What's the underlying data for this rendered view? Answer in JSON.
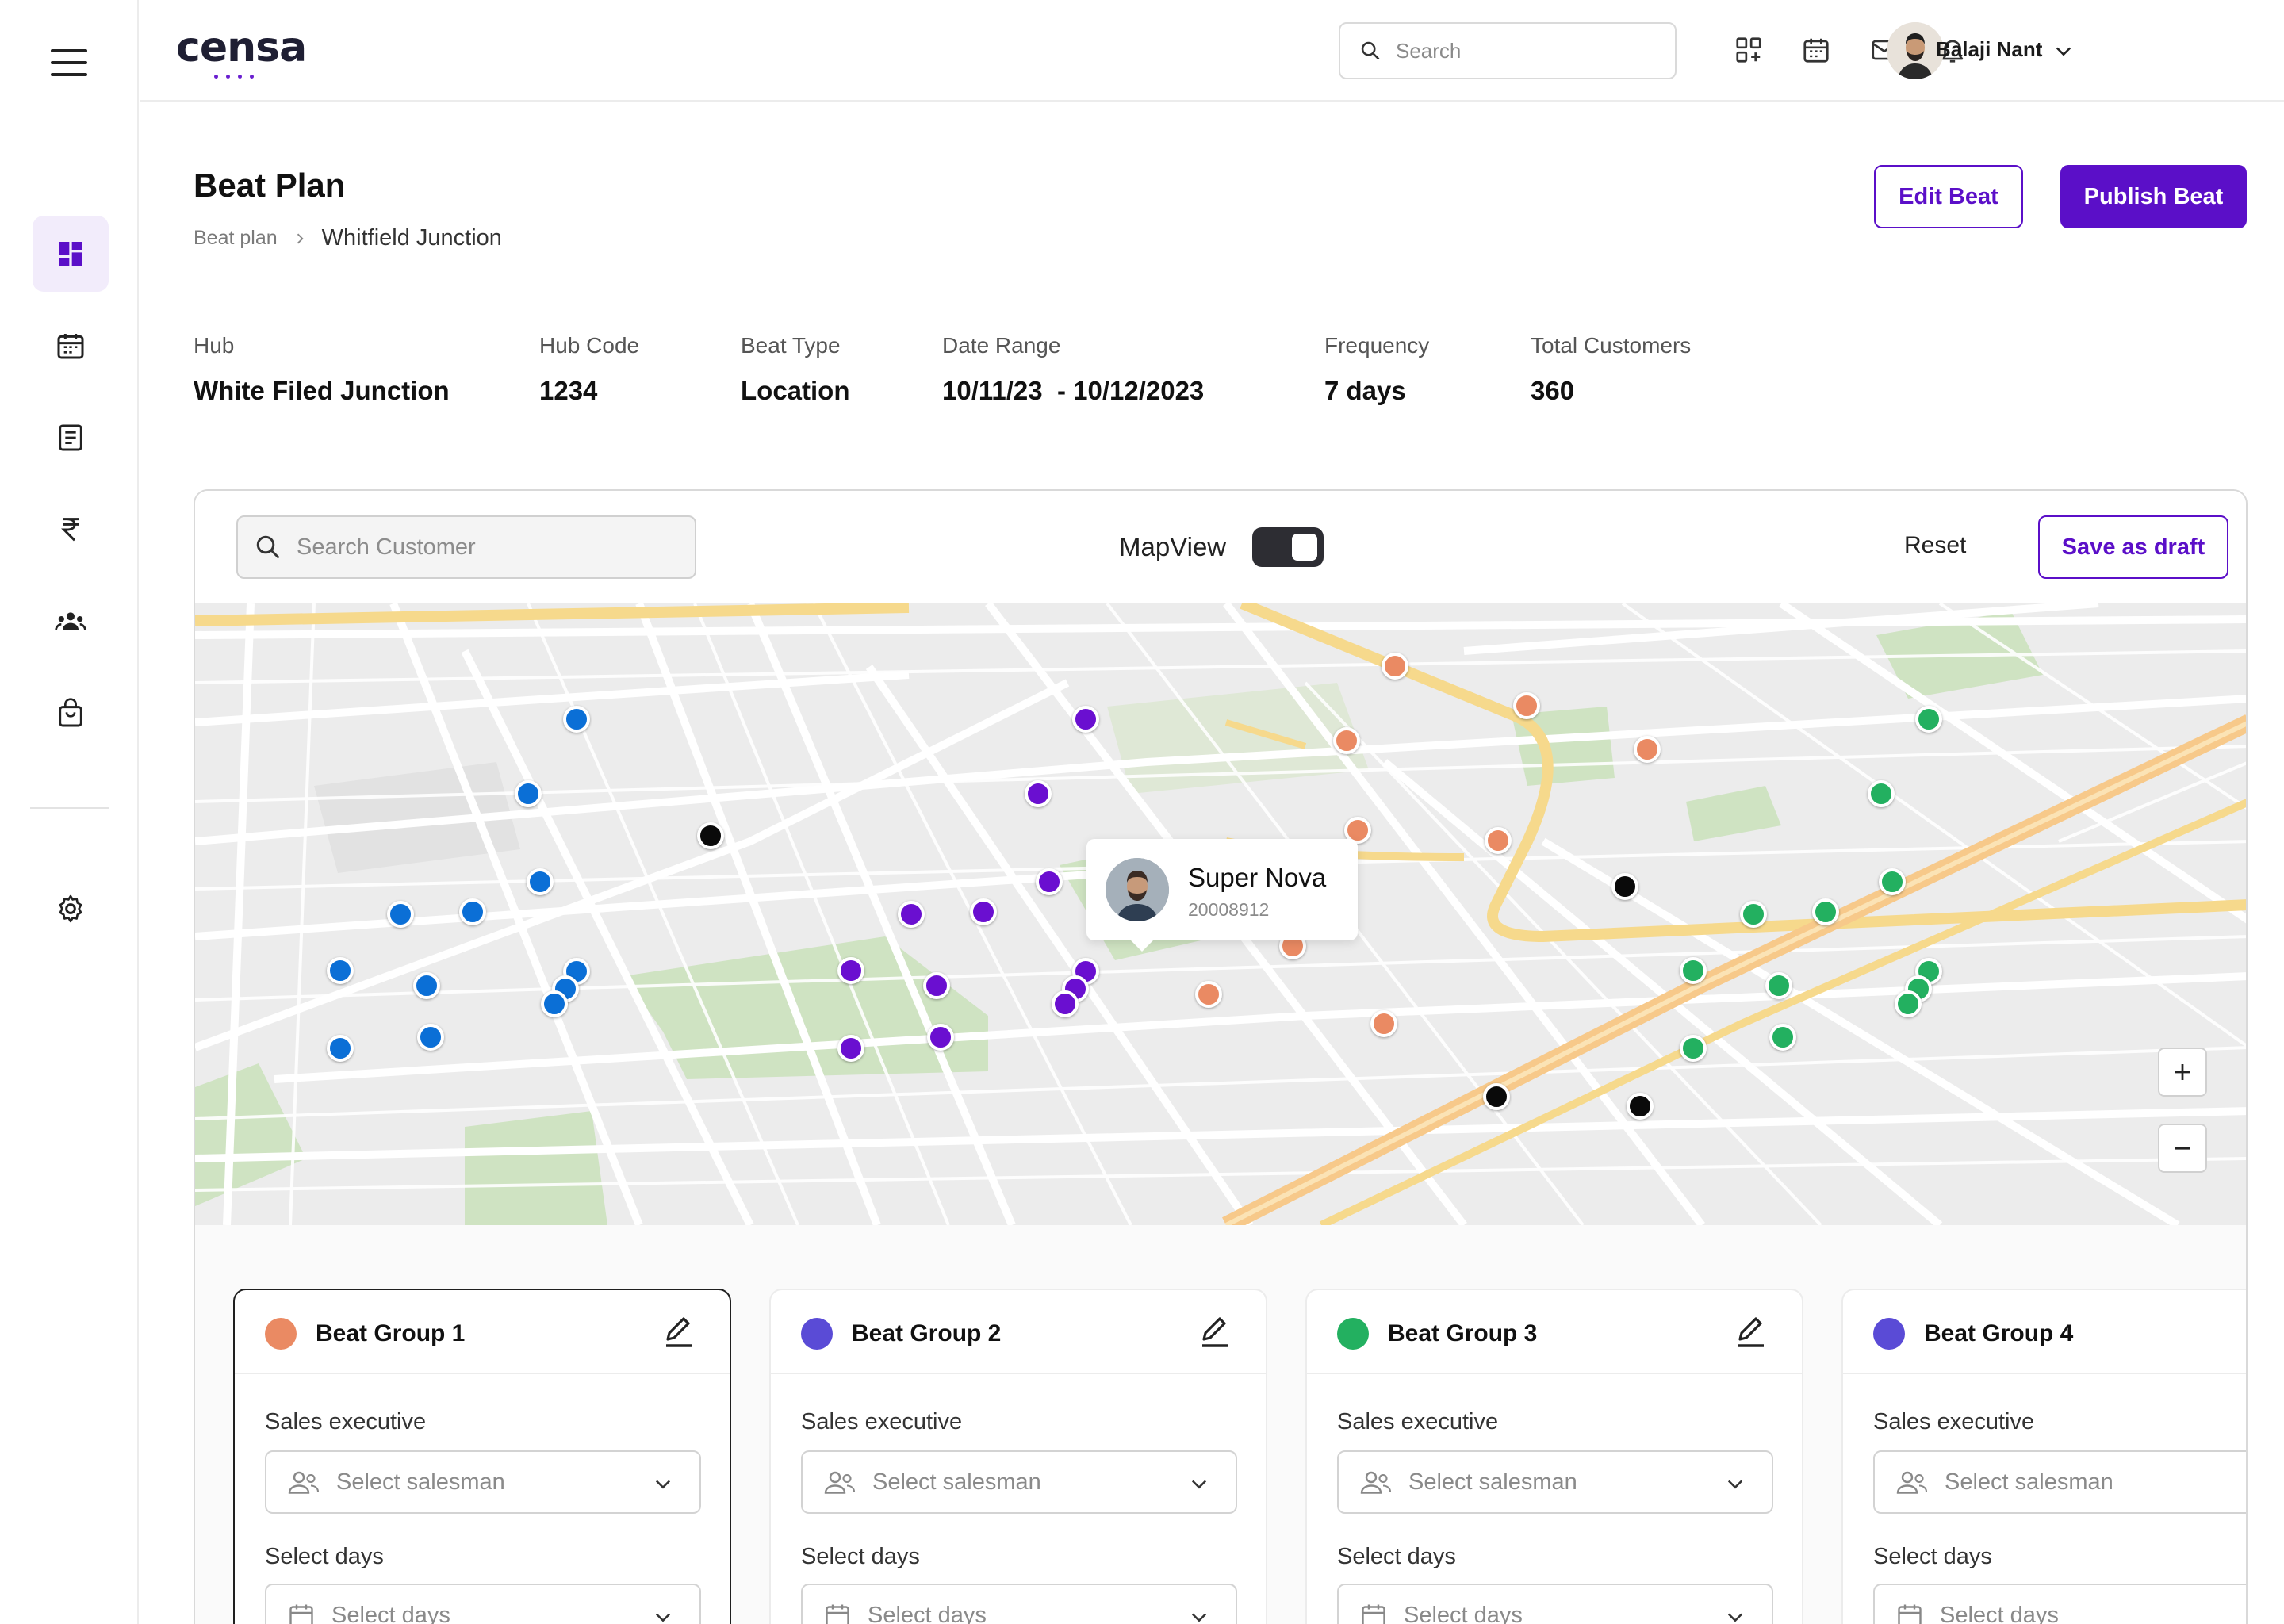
{
  "app": {
    "logo_text": "censa"
  },
  "sidebar": {
    "items": [
      {
        "name": "dashboard",
        "icon": "dashboard-icon",
        "active": true
      },
      {
        "name": "calendar",
        "icon": "calendar-icon",
        "active": false
      },
      {
        "name": "document",
        "icon": "document-icon",
        "active": false
      },
      {
        "name": "payments",
        "icon": "rupee-icon",
        "active": false
      },
      {
        "name": "team",
        "icon": "team-icon",
        "active": false
      },
      {
        "name": "orders",
        "icon": "bag-icon",
        "active": false
      },
      {
        "name": "settings",
        "icon": "gear-icon",
        "active": false
      }
    ]
  },
  "header": {
    "search_placeholder": "Search",
    "icons": [
      "apps-add-icon",
      "calendar-icon",
      "mail-icon",
      "bell-icon"
    ],
    "user_name": "Balaji Nant"
  },
  "page": {
    "title": "Beat Plan",
    "breadcrumb": [
      "Beat plan",
      "Whitfield Junction"
    ],
    "edit_label": "Edit Beat",
    "publish_label": "Publish Beat"
  },
  "info": [
    {
      "label": "Hub",
      "value": "White Filed Junction"
    },
    {
      "label": "Hub Code",
      "value": "1234"
    },
    {
      "label": "Beat Type",
      "value": "Location"
    },
    {
      "label": "Date Range",
      "value": "10/11/23  - 10/12/2023"
    },
    {
      "label": "Frequency",
      "value": "7 days"
    },
    {
      "label": "Total Customers",
      "value": "360"
    }
  ],
  "toolbar": {
    "search_placeholder": "Search Customer",
    "mapview_label": "MapView",
    "mapview_on": true,
    "reset_label": "Reset",
    "draft_label": "Save as draft"
  },
  "map": {
    "tooltip": {
      "name": "Super Nova",
      "code": "20008912"
    },
    "colors": {
      "blue": "#0b6fd6",
      "purple": "#6a0fd0",
      "orange": "#ea8a63",
      "green": "#23b060",
      "black": "#0a0a0a"
    }
  },
  "groups": [
    {
      "title": "Beat Group 1",
      "color": "#ea8a63",
      "sales_label": "Sales executive",
      "sales_placeholder": "Select salesman",
      "days_label": "Select days",
      "days_placeholder": "Select days"
    },
    {
      "title": "Beat Group 2",
      "color": "#5a4bd6",
      "sales_label": "Sales executive",
      "sales_placeholder": "Select salesman",
      "days_label": "Select days",
      "days_placeholder": "Select days"
    },
    {
      "title": "Beat Group 3",
      "color": "#23b060",
      "sales_label": "Sales executive",
      "sales_placeholder": "Select salesman",
      "days_label": "Select days",
      "days_placeholder": "Select days"
    },
    {
      "title": "Beat Group 4",
      "color": "#5a4bd6",
      "sales_label": "Sales executive",
      "sales_placeholder": "Select salesman",
      "days_label": "Select days",
      "days_placeholder": "Select days"
    }
  ]
}
